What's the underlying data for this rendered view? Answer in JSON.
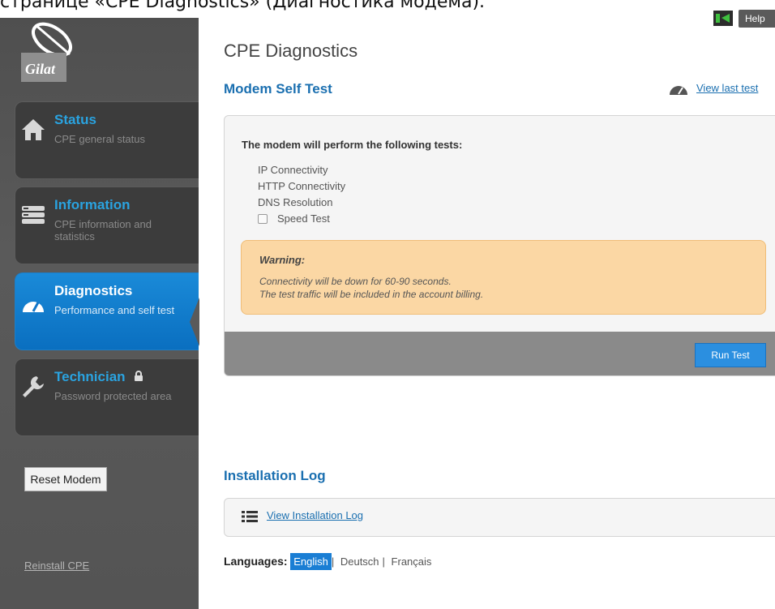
{
  "caption": "странице «CPE Diagnostics» (Диагностика модема).",
  "brand": {
    "logo_text": "Gilat"
  },
  "topbar": {
    "flag_icon": "language-flag-icon",
    "help_label": "Help"
  },
  "nav": [
    {
      "title": "Status",
      "desc": "CPE general status",
      "icon": "home-icon"
    },
    {
      "title": "Information",
      "desc": "CPE information and statistics",
      "icon": "info-list-icon"
    },
    {
      "title": "Diagnostics",
      "desc": "Performance and self test",
      "icon": "gauge-icon",
      "active": true
    },
    {
      "title": "Technician",
      "desc": "Password protected area",
      "icon": "wrench-icon",
      "locked": true
    }
  ],
  "sidebar": {
    "reset_label": "Reset Modem",
    "reinstall_label": "Reinstall CPE"
  },
  "page": {
    "title": "CPE Diagnostics"
  },
  "self_test": {
    "title": "Modem Self Test",
    "view_last_label": "View last test",
    "heading": "The modem will perform the following tests:",
    "tests": [
      "IP Connectivity",
      "HTTP Connectivity",
      "DNS Resolution"
    ],
    "optional_test": {
      "label": "Speed Test",
      "checked": false
    },
    "warning": {
      "title": "Warning:",
      "lines": [
        "Connectivity will be down for 60-90 seconds.",
        "The test traffic will be included in the account billing."
      ]
    },
    "run_label": "Run Test"
  },
  "install_log": {
    "title": "Installation Log",
    "link_label": "View Installation Log"
  },
  "languages": {
    "label": "Languages:",
    "options": [
      "English",
      "Deutsch",
      "Français"
    ],
    "selected": "English"
  },
  "colors": {
    "accent": "#1a6fb0",
    "active_nav": "#0a6fc0",
    "warning_bg": "#fbd7a4",
    "sidebar_bg": "#545454"
  }
}
